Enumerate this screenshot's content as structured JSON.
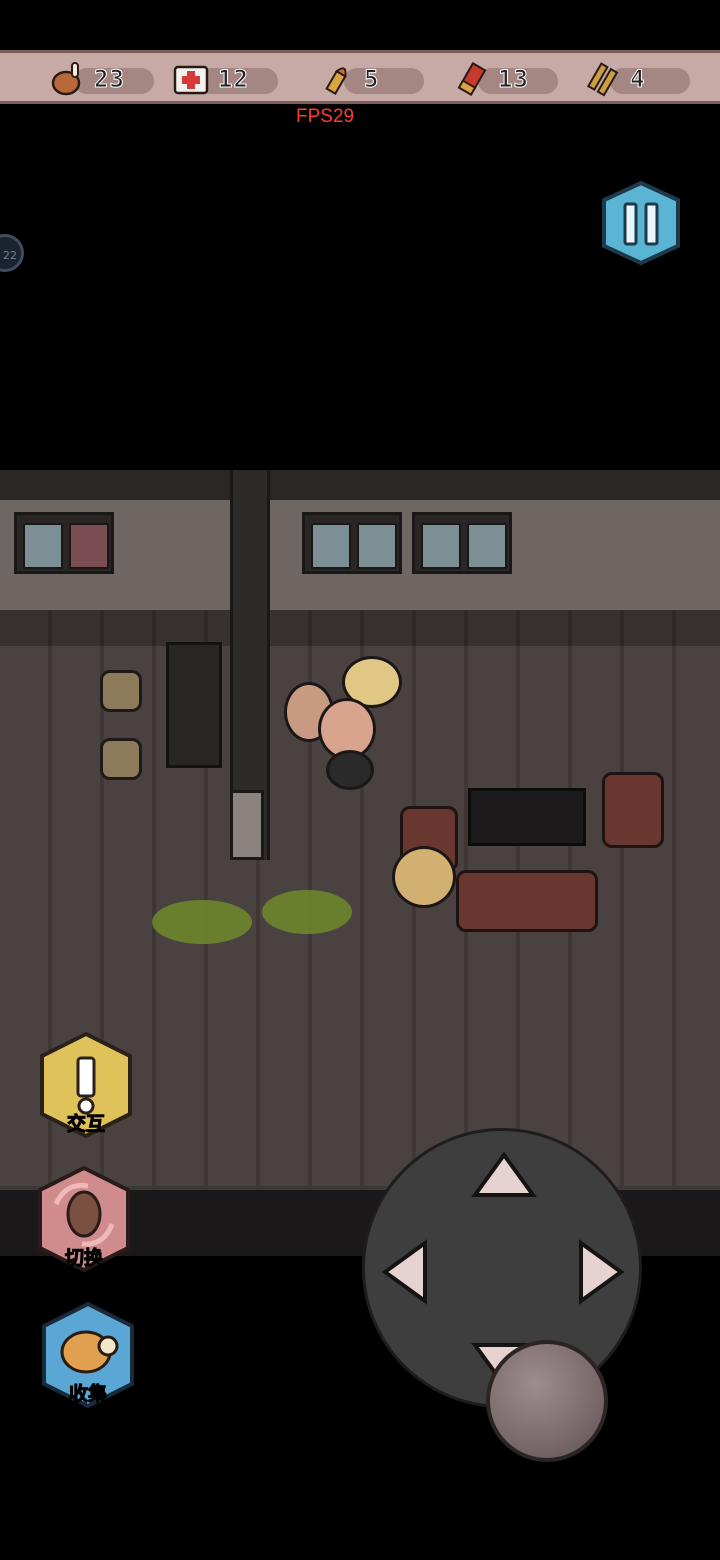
{
  "resources": [
    {
      "icon": "meat-drumstick-icon",
      "value": "23"
    },
    {
      "icon": "medkit-icon",
      "value": "12"
    },
    {
      "icon": "pistol-bullet-icon",
      "value": "5"
    },
    {
      "icon": "shotgun-shell-icon",
      "value": "13"
    },
    {
      "icon": "rifle-ammo-icon",
      "value": "4"
    }
  ],
  "fps": "FPS29",
  "side_badge": "22",
  "actions": {
    "interact": {
      "label": "交互",
      "icon": "exclamation-icon"
    },
    "switch": {
      "label": "切换",
      "icon": "weapon-switch-icon"
    },
    "collect": {
      "label": "收集",
      "icon": "collect-dog-icon"
    }
  },
  "colors": {
    "fps": "#ff3b30",
    "resource_bar": "#c7aaa5",
    "pause_button": "#5ab4d4",
    "interact_button": "#e0c25a",
    "switch_button": "#d08c8c",
    "collect_button": "#5aa6d4"
  }
}
